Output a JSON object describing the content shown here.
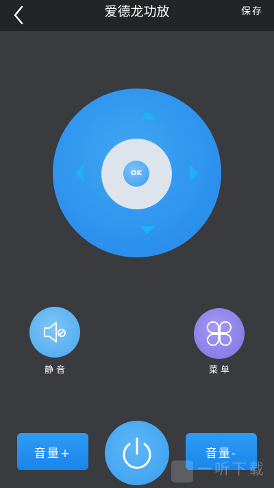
{
  "header": {
    "title": "爱德龙功放",
    "save_label": "保存",
    "back_icon": "chevron-left-icon"
  },
  "dpad": {
    "ok_label": "OK",
    "colors": {
      "pad": "#2b90ec",
      "center": "#dde4ec",
      "arrows": "#1fb0f6"
    }
  },
  "buttons": {
    "mute": {
      "label": "静音",
      "icon": "speaker-mute-icon",
      "color": "#56acf0"
    },
    "menu": {
      "label": "菜单",
      "icon": "four-petal-menu-icon",
      "color": "#8c82ea"
    },
    "volume_up": {
      "label": "音量+"
    },
    "volume_down": {
      "label": "音量-"
    },
    "power": {
      "icon": "power-icon",
      "color": "#3a9ef0"
    }
  },
  "watermark": {
    "text": "一听下载"
  }
}
